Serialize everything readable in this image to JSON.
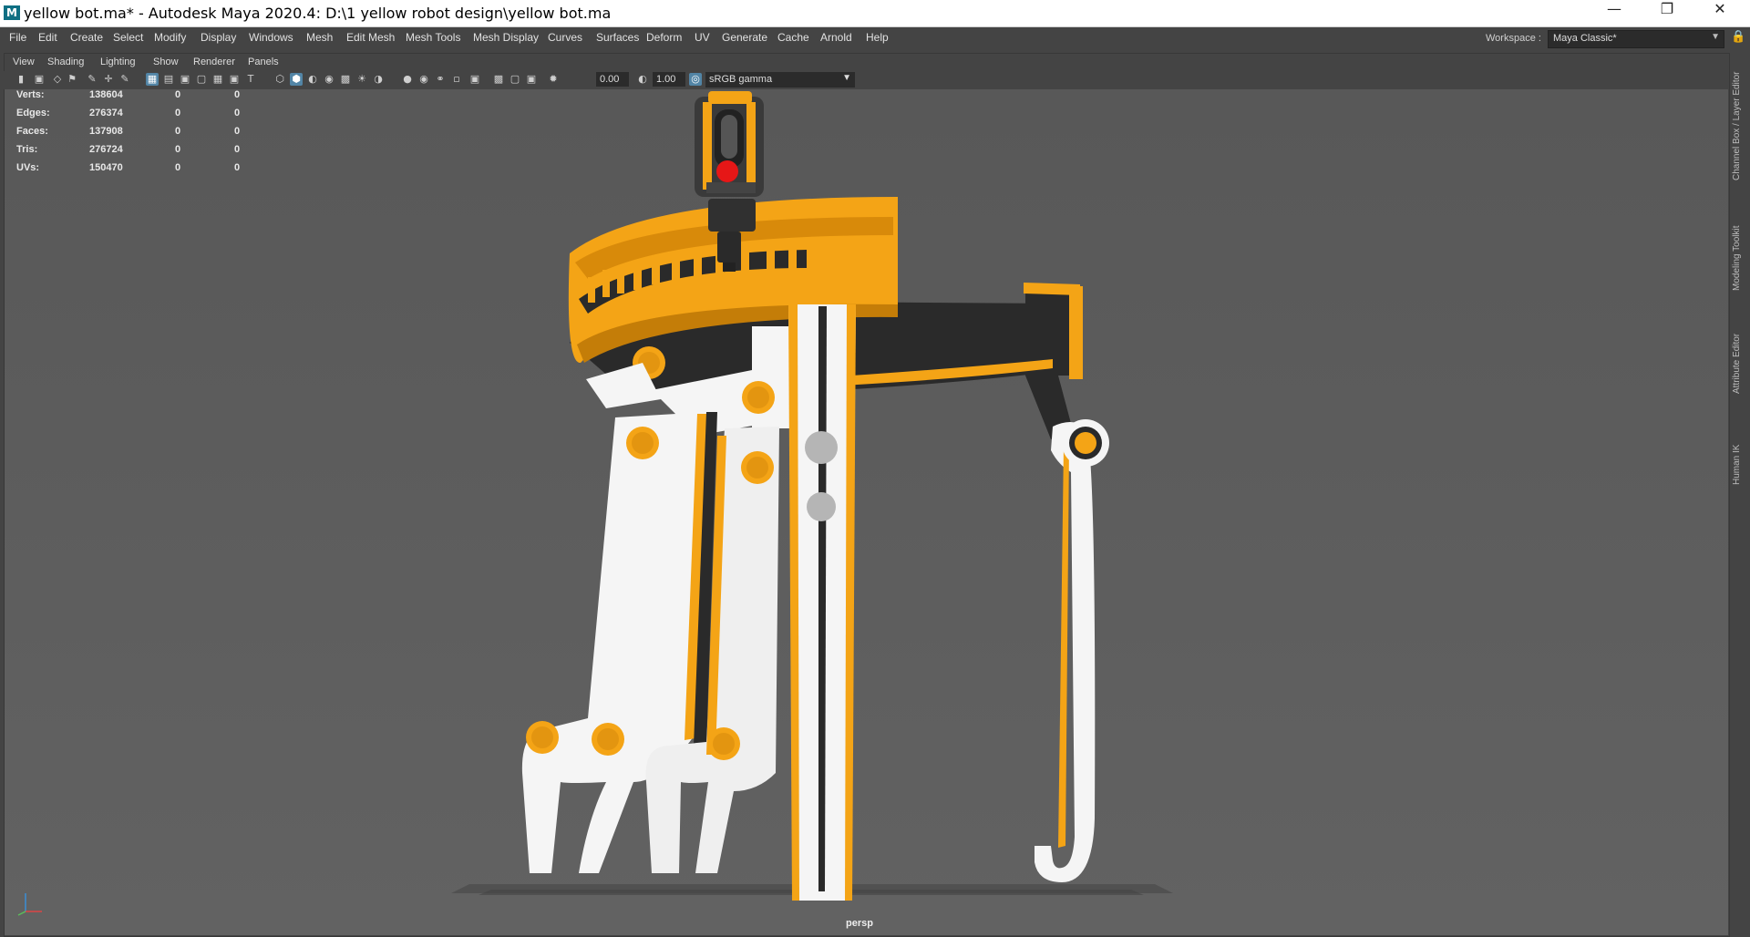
{
  "window": {
    "icon": "M",
    "title": "yellow bot.ma* - Autodesk Maya 2020.4: D:\\1 yellow robot design\\yellow bot.ma",
    "controls": [
      "minimize-icon",
      "restore-icon",
      "close-icon"
    ]
  },
  "menubar": {
    "items": [
      "File",
      "Edit",
      "Create",
      "Select",
      "Modify",
      "Display",
      "Windows",
      "Mesh",
      "Edit Mesh",
      "Mesh Tools",
      "Mesh Display",
      "Curves",
      "Surfaces",
      "Deform",
      "UV",
      "Generate",
      "Cache",
      "Arnold",
      "Help"
    ],
    "workspace_label": "Workspace :",
    "workspace_value": "Maya Classic*"
  },
  "panel": {
    "menu": [
      "View",
      "Shading",
      "Lighting",
      "Show",
      "Renderer",
      "Panels"
    ],
    "toolbar": {
      "exposure": "0.00",
      "gamma": "1.00",
      "color_space": "sRGB gamma"
    }
  },
  "hud": {
    "rows": [
      {
        "label": "Verts:",
        "total": "138604",
        "sel": "0",
        "selfrag": "0"
      },
      {
        "label": "Edges:",
        "total": "276374",
        "sel": "0",
        "selfrag": "0"
      },
      {
        "label": "Faces:",
        "total": "137908",
        "sel": "0",
        "selfrag": "0"
      },
      {
        "label": "Tris:",
        "total": "276724",
        "sel": "0",
        "selfrag": "0"
      },
      {
        "label": "UVs:",
        "total": "150470",
        "sel": "0",
        "selfrag": "0"
      }
    ]
  },
  "viewport": {
    "camera": "persp",
    "model_colors": {
      "yellow": "#f4a416",
      "white": "#f5f5f5",
      "dark": "#2a2a2a",
      "light": "#e61717"
    }
  },
  "sidebar": {
    "tabs": [
      "Channel Box / Layer Editor",
      "Modeling Toolkit",
      "Attribute Editor",
      "Human IK"
    ]
  }
}
